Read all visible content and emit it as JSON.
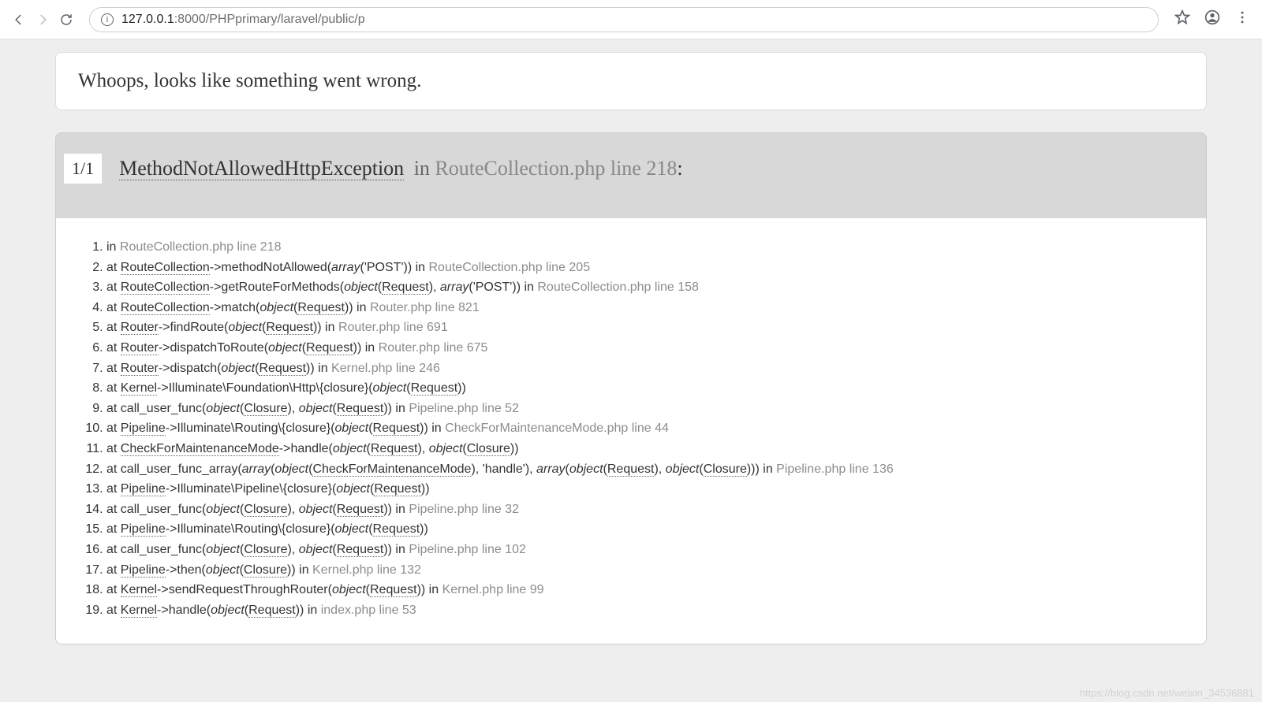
{
  "browser": {
    "url_host": "127.0.0.1",
    "url_rest": ":8000/PHPprimary/laravel/public/p"
  },
  "title": "Whoops, looks like something went wrong.",
  "exception": {
    "counter": "1/1",
    "name": "MethodNotAllowedHttpException",
    "in": " in ",
    "location": "RouteCollection.php line 218",
    "colon": ":"
  },
  "trace": [
    {
      "n": 1,
      "segments": [
        "in ",
        [
          "muted",
          "RouteCollection.php line 218"
        ]
      ]
    },
    {
      "n": 2,
      "segments": [
        "at ",
        [
          "ul",
          "RouteCollection"
        ],
        "->methodNotAllowed(",
        [
          "em",
          "array"
        ],
        "('POST')) in ",
        [
          "muted",
          "RouteCollection.php line 205"
        ]
      ]
    },
    {
      "n": 3,
      "segments": [
        "at ",
        [
          "ul",
          "RouteCollection"
        ],
        "->getRouteForMethods(",
        [
          "em",
          "object"
        ],
        "(",
        [
          "ul",
          "Request"
        ],
        "), ",
        [
          "em",
          "array"
        ],
        "('POST')) in ",
        [
          "muted",
          "RouteCollection.php line 158"
        ]
      ]
    },
    {
      "n": 4,
      "segments": [
        "at ",
        [
          "ul",
          "RouteCollection"
        ],
        "->match(",
        [
          "em",
          "object"
        ],
        "(",
        [
          "ul",
          "Request"
        ],
        ")) in ",
        [
          "muted",
          "Router.php line 821"
        ]
      ]
    },
    {
      "n": 5,
      "segments": [
        "at ",
        [
          "ul",
          "Router"
        ],
        "->findRoute(",
        [
          "em",
          "object"
        ],
        "(",
        [
          "ul",
          "Request"
        ],
        ")) in ",
        [
          "muted",
          "Router.php line 691"
        ]
      ]
    },
    {
      "n": 6,
      "segments": [
        "at ",
        [
          "ul",
          "Router"
        ],
        "->dispatchToRoute(",
        [
          "em",
          "object"
        ],
        "(",
        [
          "ul",
          "Request"
        ],
        ")) in ",
        [
          "muted",
          "Router.php line 675"
        ]
      ]
    },
    {
      "n": 7,
      "segments": [
        "at ",
        [
          "ul",
          "Router"
        ],
        "->dispatch(",
        [
          "em",
          "object"
        ],
        "(",
        [
          "ul",
          "Request"
        ],
        ")) in ",
        [
          "muted",
          "Kernel.php line 246"
        ]
      ]
    },
    {
      "n": 8,
      "segments": [
        "at ",
        [
          "ul",
          "Kernel"
        ],
        "->Illuminate\\Foundation\\Http\\{closure}(",
        [
          "em",
          "object"
        ],
        "(",
        [
          "ul",
          "Request"
        ],
        "))"
      ]
    },
    {
      "n": 9,
      "segments": [
        "at call_user_func(",
        [
          "em",
          "object"
        ],
        "(",
        [
          "ul",
          "Closure"
        ],
        "), ",
        [
          "em",
          "object"
        ],
        "(",
        [
          "ul",
          "Request"
        ],
        ")) in ",
        [
          "muted",
          "Pipeline.php line 52"
        ]
      ]
    },
    {
      "n": 10,
      "segments": [
        "at ",
        [
          "ul",
          "Pipeline"
        ],
        "->Illuminate\\Routing\\{closure}(",
        [
          "em",
          "object"
        ],
        "(",
        [
          "ul",
          "Request"
        ],
        ")) in ",
        [
          "muted",
          "CheckForMaintenanceMode.php line 44"
        ]
      ]
    },
    {
      "n": 11,
      "segments": [
        "at ",
        [
          "ul",
          "CheckForMaintenanceMode"
        ],
        "->handle(",
        [
          "em",
          "object"
        ],
        "(",
        [
          "ul",
          "Request"
        ],
        "), ",
        [
          "em",
          "object"
        ],
        "(",
        [
          "ul",
          "Closure"
        ],
        "))"
      ]
    },
    {
      "n": 12,
      "segments": [
        "at call_user_func_array(",
        [
          "em",
          "array"
        ],
        "(",
        [
          "em",
          "object"
        ],
        "(",
        [
          "ul",
          "CheckForMaintenanceMode"
        ],
        "), 'handle'), ",
        [
          "em",
          "array"
        ],
        "(",
        [
          "em",
          "object"
        ],
        "(",
        [
          "ul",
          "Request"
        ],
        "), ",
        [
          "em",
          "object"
        ],
        "(",
        [
          "ul",
          "Closure"
        ],
        "))) in ",
        [
          "muted",
          "Pipeline.php line 136"
        ]
      ]
    },
    {
      "n": 13,
      "segments": [
        "at ",
        [
          "ul",
          "Pipeline"
        ],
        "->Illuminate\\Pipeline\\{closure}(",
        [
          "em",
          "object"
        ],
        "(",
        [
          "ul",
          "Request"
        ],
        "))"
      ]
    },
    {
      "n": 14,
      "segments": [
        "at call_user_func(",
        [
          "em",
          "object"
        ],
        "(",
        [
          "ul",
          "Closure"
        ],
        "), ",
        [
          "em",
          "object"
        ],
        "(",
        [
          "ul",
          "Request"
        ],
        ")) in ",
        [
          "muted",
          "Pipeline.php line 32"
        ]
      ]
    },
    {
      "n": 15,
      "segments": [
        "at ",
        [
          "ul",
          "Pipeline"
        ],
        "->Illuminate\\Routing\\{closure}(",
        [
          "em",
          "object"
        ],
        "(",
        [
          "ul",
          "Request"
        ],
        "))"
      ]
    },
    {
      "n": 16,
      "segments": [
        "at call_user_func(",
        [
          "em",
          "object"
        ],
        "(",
        [
          "ul",
          "Closure"
        ],
        "), ",
        [
          "em",
          "object"
        ],
        "(",
        [
          "ul",
          "Request"
        ],
        ")) in ",
        [
          "muted",
          "Pipeline.php line 102"
        ]
      ]
    },
    {
      "n": 17,
      "segments": [
        "at ",
        [
          "ul",
          "Pipeline"
        ],
        "->then(",
        [
          "em",
          "object"
        ],
        "(",
        [
          "ul",
          "Closure"
        ],
        ")) in ",
        [
          "muted",
          "Kernel.php line 132"
        ]
      ]
    },
    {
      "n": 18,
      "segments": [
        "at ",
        [
          "ul",
          "Kernel"
        ],
        "->sendRequestThroughRouter(",
        [
          "em",
          "object"
        ],
        "(",
        [
          "ul",
          "Request"
        ],
        ")) in ",
        [
          "muted",
          "Kernel.php line 99"
        ]
      ]
    },
    {
      "n": 19,
      "segments": [
        "at ",
        [
          "ul",
          "Kernel"
        ],
        "->handle(",
        [
          "em",
          "object"
        ],
        "(",
        [
          "ul",
          "Request"
        ],
        ")) in ",
        [
          "muted",
          "index.php line 53"
        ]
      ]
    }
  ],
  "watermark": "https://blog.csdn.net/weixin_34536881"
}
